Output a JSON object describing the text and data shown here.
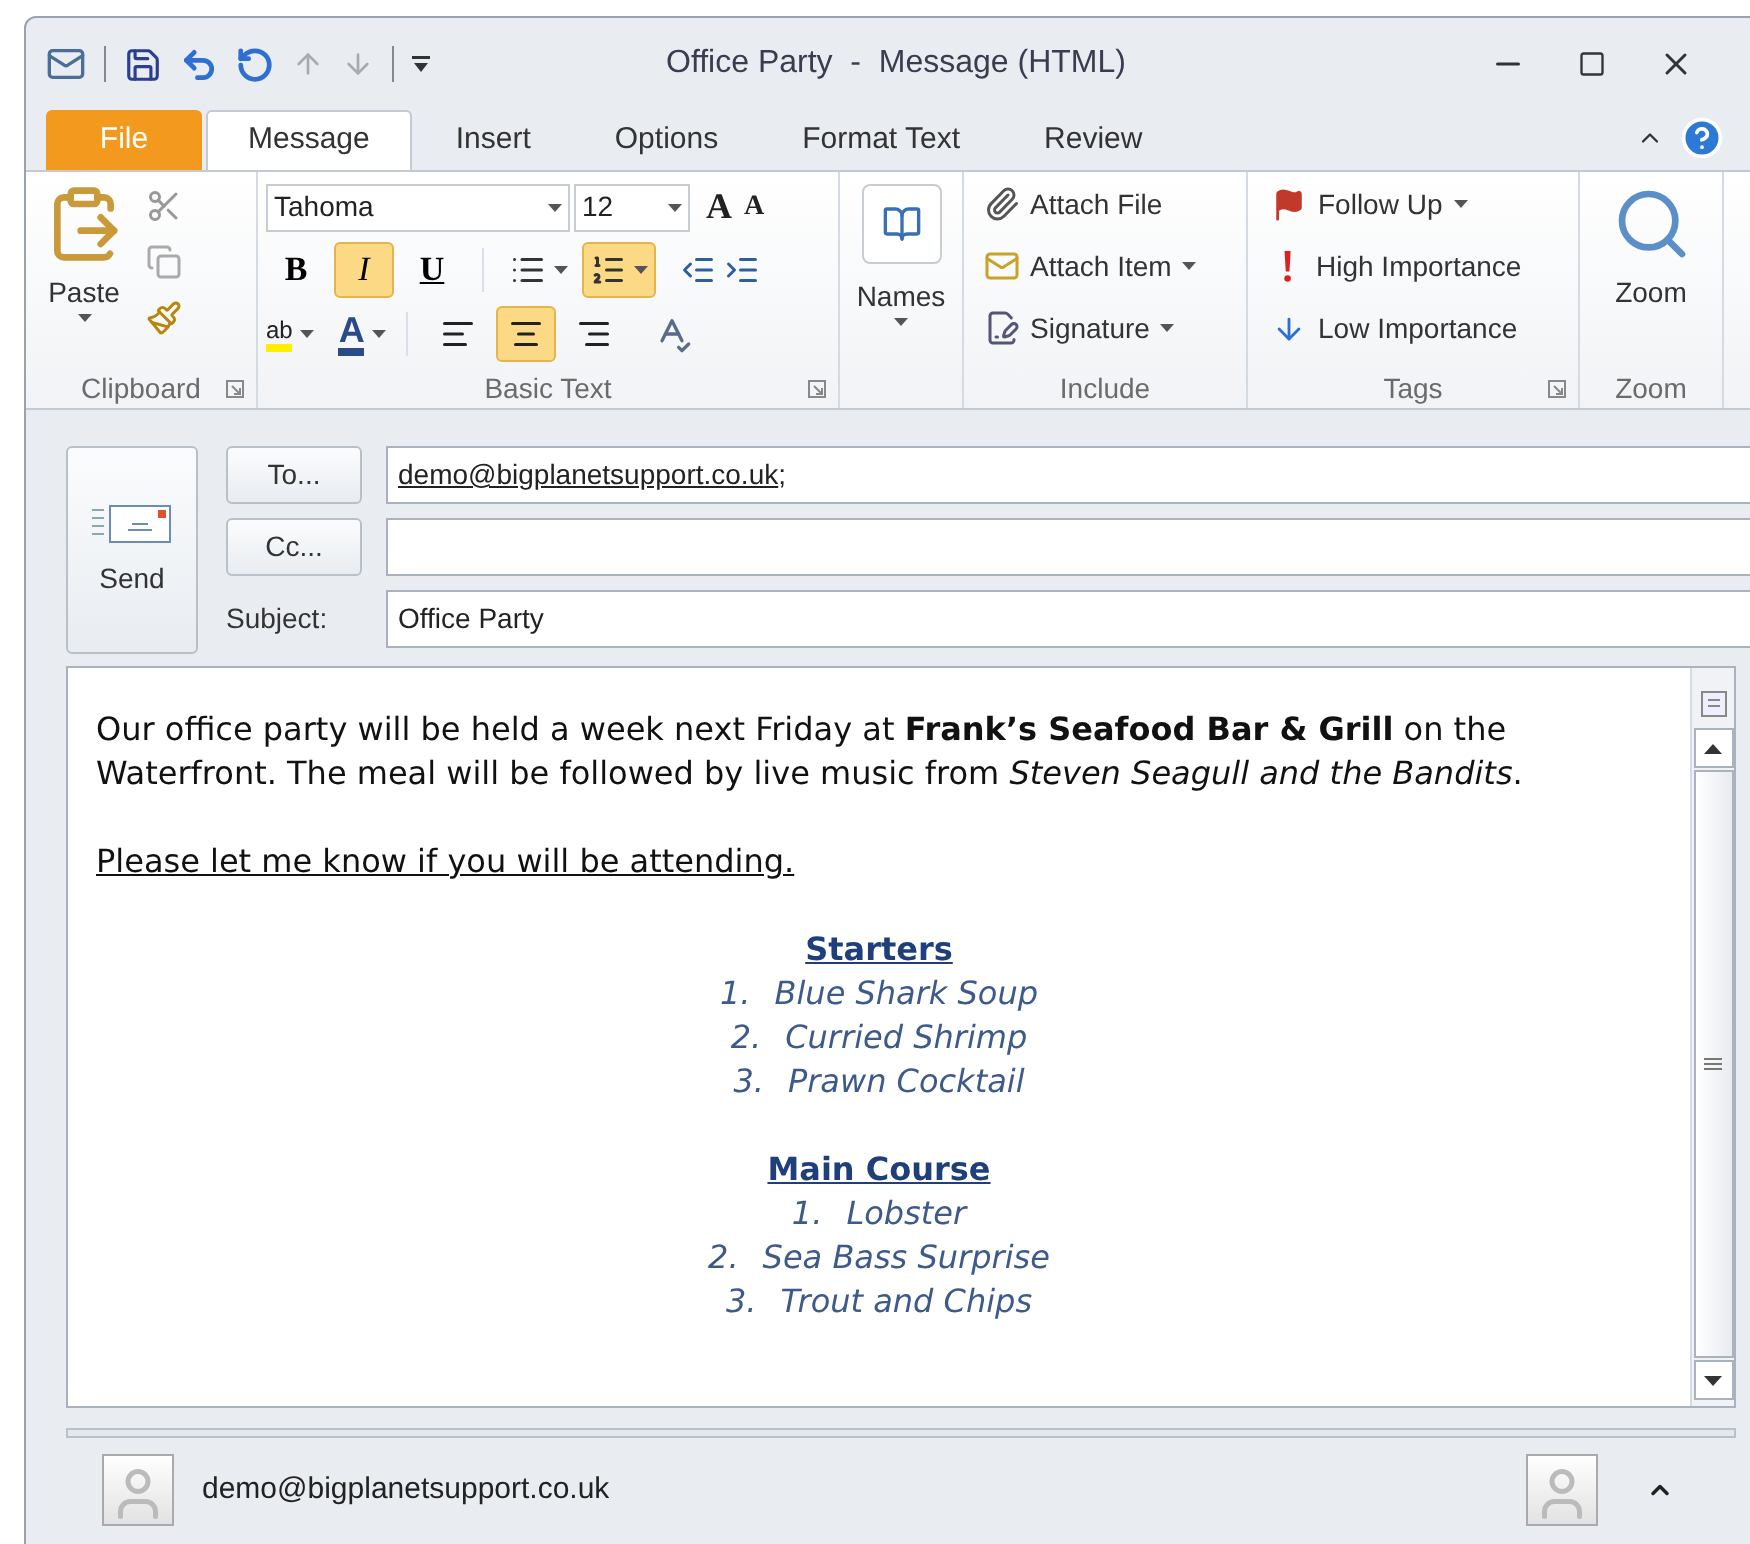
{
  "window": {
    "title": "Office Party  -  Message (HTML)"
  },
  "ribbon_tabs": [
    {
      "label": "File",
      "kind": "file",
      "selected": false
    },
    {
      "label": "Message",
      "kind": "tab",
      "selected": true
    },
    {
      "label": "Insert",
      "kind": "tab",
      "selected": false
    },
    {
      "label": "Options",
      "kind": "tab",
      "selected": false
    },
    {
      "label": "Format Text",
      "kind": "tab",
      "selected": false
    },
    {
      "label": "Review",
      "kind": "tab",
      "selected": false
    }
  ],
  "clipboard": {
    "paste": "Paste",
    "label": "Clipboard"
  },
  "basic_text": {
    "font": "Tahoma",
    "size": "12",
    "grow": "A",
    "shrink": "A",
    "format": [
      {
        "label": "B",
        "kind": "bold",
        "selected": false
      },
      {
        "label": "I",
        "kind": "italic",
        "selected": true
      },
      {
        "label": "U",
        "kind": "underline",
        "selected": false
      }
    ],
    "lists": [
      {
        "kind": "bullets",
        "selected": false
      },
      {
        "kind": "numbering",
        "selected": true
      }
    ],
    "highlight": "ab",
    "font_color": "A",
    "align": [
      {
        "kind": "left",
        "selected": false
      },
      {
        "kind": "center",
        "selected": true
      },
      {
        "kind": "right",
        "selected": false
      }
    ],
    "label": "Basic Text"
  },
  "names": {
    "label": "Names"
  },
  "include": {
    "items": [
      {
        "label": "Attach File",
        "kind": "attach_file",
        "dropdown": false
      },
      {
        "label": "Attach Item",
        "kind": "attach_item",
        "dropdown": true
      },
      {
        "label": "Signature",
        "kind": "signature",
        "dropdown": true
      }
    ],
    "label": "Include"
  },
  "tags": {
    "items": [
      {
        "label": "Follow Up",
        "kind": "follow_up",
        "dropdown": true
      },
      {
        "label": "High Importance",
        "kind": "high",
        "dropdown": false
      },
      {
        "label": "Low Importance",
        "kind": "low",
        "dropdown": false
      }
    ],
    "label": "Tags"
  },
  "zoom": {
    "button": "Zoom",
    "label": "Zoom"
  },
  "compose": {
    "send": "Send",
    "to_button": "To...",
    "to_address": "demo@bigplanetsupport.co.uk",
    "to_separator": ";",
    "cc_button": "Cc...",
    "subject_label": "Subject:",
    "subject": "Office Party"
  },
  "body": {
    "paragraphs": [
      {
        "text": "Our office party will be held a week next Friday at **Frank’s Seafood Bar & Grill** on the Waterfront. The meal will be followed by live music from *Steven Seagull and the Bandits*.",
        "underlined": false
      },
      {
        "text": "Please let me know if you will be attending.",
        "underlined": true
      }
    ],
    "sections": [
      {
        "heading": "Starters",
        "items": [
          {
            "number": "1.",
            "text": "Blue Shark Soup"
          },
          {
            "number": "2.",
            "text": "Curried Shrimp"
          },
          {
            "number": "3.",
            "text": "Prawn Cocktail"
          }
        ]
      },
      {
        "heading": "Main Course",
        "items": [
          {
            "number": "1.",
            "text": "Lobster"
          },
          {
            "number": "2.",
            "text": "Sea Bass Surprise"
          },
          {
            "number": "3.",
            "text": "Trout and Chips"
          }
        ]
      }
    ]
  },
  "people_pane": {
    "contact": "demo@bigplanetsupport.co.uk"
  }
}
